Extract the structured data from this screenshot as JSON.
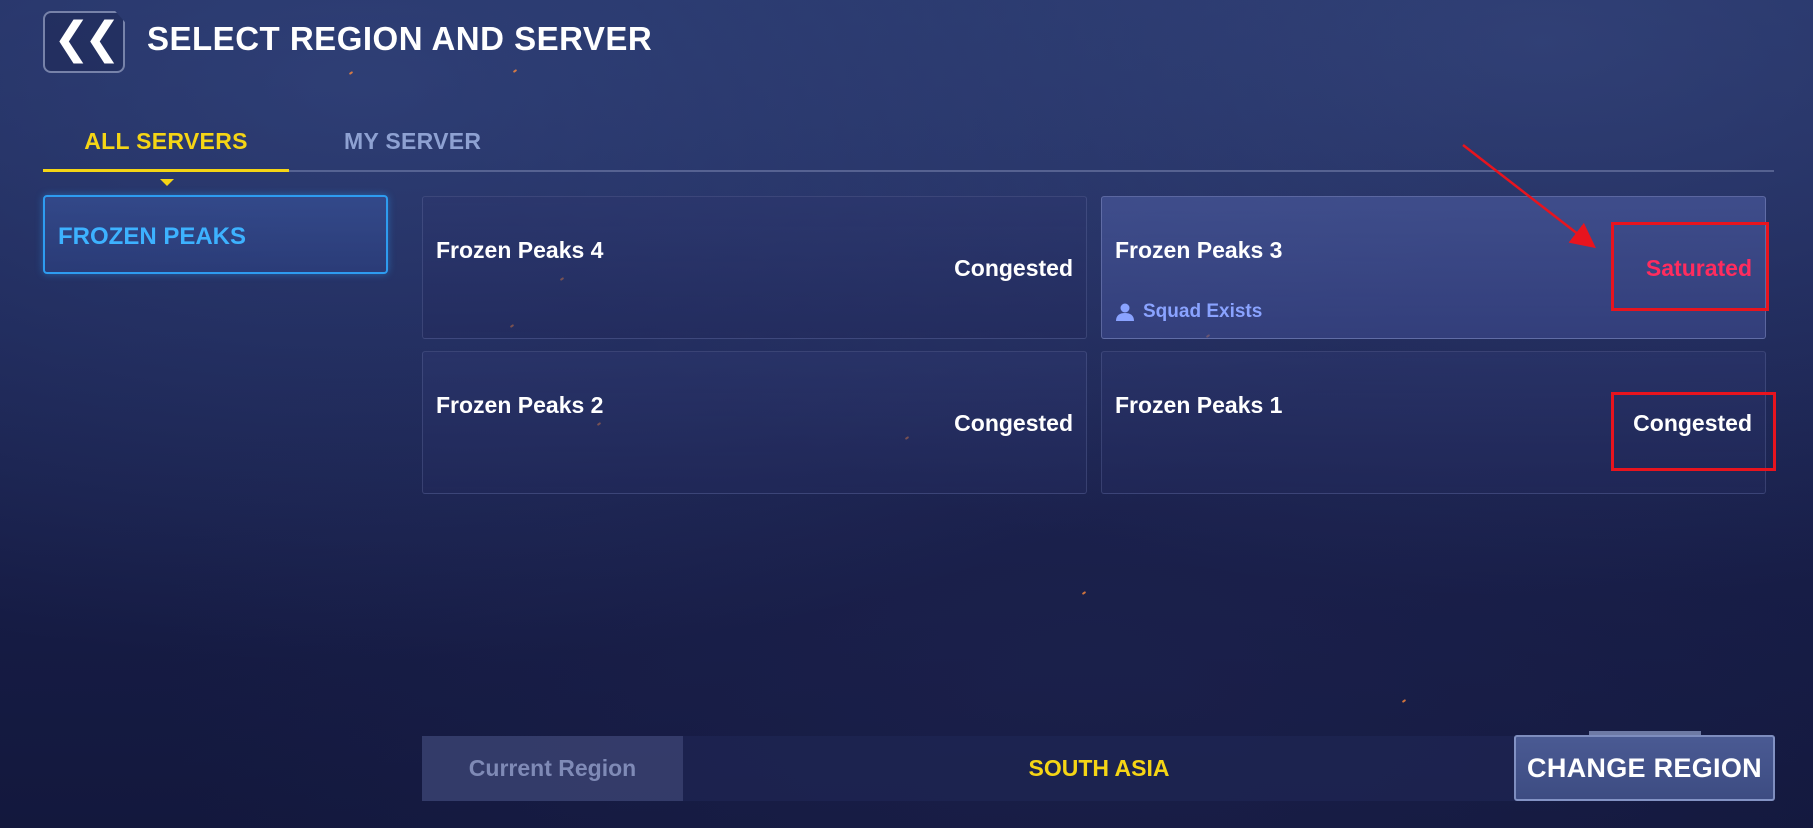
{
  "header": {
    "back_icon": "double-chevron-left-icon",
    "title": "SELECT REGION AND SERVER"
  },
  "tabs": [
    {
      "label": "ALL SERVERS",
      "active": true
    },
    {
      "label": "MY SERVER",
      "active": false
    }
  ],
  "regions": [
    {
      "label": "FROZEN PEAKS",
      "selected": true
    }
  ],
  "servers": [
    {
      "name": "Frozen Peaks 4",
      "status": "Congested",
      "squad": ""
    },
    {
      "name": "Frozen Peaks 3",
      "status": "Saturated",
      "squad": "Squad Exists"
    },
    {
      "name": "Frozen Peaks 2",
      "status": "Congested",
      "squad": ""
    },
    {
      "name": "Frozen Peaks 1",
      "status": "Congested",
      "squad": ""
    }
  ],
  "footer": {
    "current_region_label": "Current Region",
    "current_region_value": "SOUTH ASIA",
    "change_region_label": "CHANGE REGION"
  },
  "colors": {
    "accent_yellow": "#f5d515",
    "region_blue": "#3db2ff",
    "saturated_red": "#ff2c5e",
    "squad_blue": "#8aa3ff",
    "annotation_red": "#e8141e"
  }
}
